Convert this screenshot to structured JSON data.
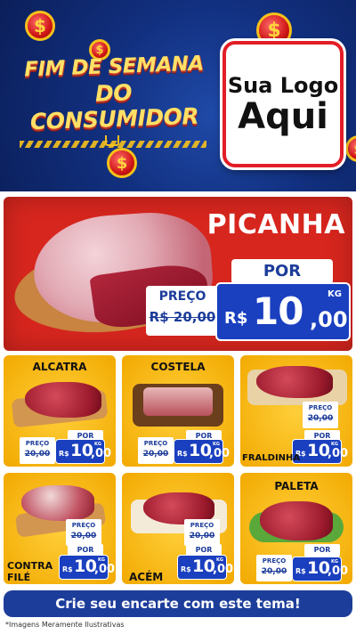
{
  "header": {
    "title_line1": "FIM DE SEMANA",
    "title_line2": "DO CONSUMIDOR",
    "coin_symbol": "$",
    "logo_line1": "Sua Logo",
    "logo_line2": "Aqui"
  },
  "featured": {
    "name": "PICANHA",
    "preco_label": "PREÇO",
    "old_price": "R$ 20,00",
    "por_label": "POR",
    "currency": "R$",
    "price_int": "10",
    "price_dec": ",00",
    "unit": "KG"
  },
  "products": [
    {
      "name": "ALCATRA",
      "preco_label": "PREÇO",
      "old_price": "20,00",
      "por_label": "POR",
      "currency": "R$",
      "price_int": "10",
      "price_dec": ",00",
      "unit": "KG"
    },
    {
      "name": "COSTELA",
      "preco_label": "PREÇO",
      "old_price": "20,00",
      "por_label": "POR",
      "currency": "R$",
      "price_int": "10",
      "price_dec": ",00",
      "unit": "KG"
    },
    {
      "name": "FRALDINHA",
      "preco_label": "PREÇO",
      "old_price": "20,00",
      "por_label": "POR",
      "currency": "R$",
      "price_int": "10",
      "price_dec": ",00",
      "unit": "KG"
    },
    {
      "name_line1": "CONTRA",
      "name_line2": "FILÉ",
      "preco_label": "PREÇO",
      "old_price": "20,00",
      "por_label": "POR",
      "currency": "R$",
      "price_int": "10",
      "price_dec": ",00",
      "unit": "KG"
    },
    {
      "name": "ACÉM",
      "preco_label": "PREÇO",
      "old_price": "20,00",
      "por_label": "POR",
      "currency": "R$",
      "price_int": "10",
      "price_dec": ",00",
      "unit": "KG"
    },
    {
      "name": "PALETA",
      "preco_label": "PREÇO",
      "old_price": "20,00",
      "por_label": "POR",
      "currency": "R$",
      "price_int": "10",
      "price_dec": ",00",
      "unit": "KG"
    }
  ],
  "cta": "Crie seu encarte com este tema!",
  "disclaimer": "*Imagens Meramente Ilustrativas",
  "colors": {
    "brand_red": "#d7261e",
    "brand_blue": "#1a3fbf",
    "card_yellow": "#f5b60d"
  }
}
